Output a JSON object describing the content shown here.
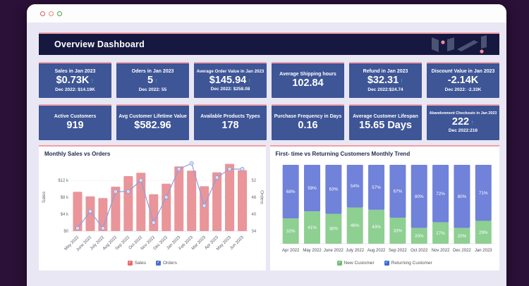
{
  "window": {
    "traffic_lights": [
      "close",
      "minimize",
      "maximize"
    ]
  },
  "header": {
    "title": "Overview Dashboard"
  },
  "kpi_rows": [
    [
      {
        "title": "Sales in Jan 2023",
        "value": "$0.73K",
        "up": true,
        "sub": "Dec 2022: $14.19K"
      },
      {
        "title": "Oders in Jan 2023",
        "value": "5",
        "up": true,
        "sub": "Dec 2022: 55"
      },
      {
        "title": "Average Order Value in Jan 2023",
        "value": "$145.94",
        "up": true,
        "sub": "Dec 2022: $258.08"
      },
      {
        "title": "Average Shipping hours",
        "value": "102.84",
        "up": false,
        "sub": ""
      },
      {
        "title": "Refund in Jan 2023",
        "value": "$32.31",
        "up": true,
        "sub": "Dec 2022:$24.74"
      },
      {
        "title": "Discount Value in Jan 2023",
        "value": "-2.14K",
        "up": false,
        "sub": "Dec 2022: -2.33K"
      }
    ],
    [
      {
        "title": "Active Customers",
        "value": "919",
        "up": false,
        "sub": ""
      },
      {
        "title": "Avg Customer Lifetime Value",
        "value": "$582.96",
        "up": false,
        "sub": ""
      },
      {
        "title": "Available Products Types",
        "value": "178",
        "up": false,
        "sub": ""
      },
      {
        "title": "Purchase Frequency in Days",
        "value": "0.16",
        "up": false,
        "sub": ""
      },
      {
        "title": "Average Customer Lifespan",
        "value": "15.65 Days",
        "up": false,
        "sub": ""
      },
      {
        "title": "Abandonment Checkouts in Jan 2023",
        "value": "222",
        "up": true,
        "sub": "Dec 2022:216"
      }
    ]
  ],
  "chart_data": [
    {
      "type": "bar",
      "subtype": "bar-line-combo",
      "title": "Monthly Sales vs Orders",
      "categories": [
        "May 2022",
        "June 2022",
        "July 2022",
        "Aug 2022",
        "Sep 2022",
        "Oct 2022",
        "Nov 2022",
        "Dec 2022",
        "Jan 2023",
        "Feb 2023",
        "Mar 2023",
        "Apr 2023",
        "May 2023",
        "Jun 2023"
      ],
      "series": [
        {
          "name": "Sales",
          "type": "bar",
          "axis": "left",
          "values": [
            9300,
            8200,
            7800,
            10500,
            13000,
            13800,
            8700,
            11200,
            15300,
            14300,
            10600,
            13900,
            15900,
            14400
          ]
        },
        {
          "name": "Orders",
          "type": "line",
          "axis": "right",
          "values": [
            35,
            41,
            35,
            48,
            48,
            52,
            37,
            46,
            56,
            58,
            43,
            53,
            56,
            56
          ]
        }
      ],
      "y_left": {
        "label": "Sales",
        "ticks": [
          "$0",
          "$4 k",
          "$8 k",
          "$12 k"
        ],
        "tick_values": [
          0,
          4000,
          8000,
          12000
        ],
        "min": 0,
        "max": 16000
      },
      "y_right": {
        "label": "Orders",
        "ticks": [
          "34",
          "40",
          "46",
          "52"
        ],
        "tick_values": [
          34,
          40,
          46,
          52
        ],
        "min": 34,
        "max": 58
      },
      "grid": true,
      "legend_position": "bottom"
    },
    {
      "type": "bar",
      "subtype": "stacked-100",
      "title": "First- time vs Returning  Customers Monthly Trend",
      "categories": [
        "Apr 2022",
        "May 2022",
        "June 2022",
        "July 2022",
        "Aug 2022",
        "Sep 2022",
        "Oct 2022",
        "Nov 2022",
        "Dec 2022",
        "Jan 2023"
      ],
      "series": [
        {
          "name": "New Customer",
          "values": [
            32,
            41,
            38,
            46,
            43,
            33,
            20,
            27,
            20,
            29
          ]
        },
        {
          "name": "Returning Customer",
          "values": [
            68,
            59,
            63,
            54,
            57,
            67,
            80,
            72,
            80,
            71
          ]
        }
      ],
      "value_suffix": "%",
      "ylim": [
        0,
        100
      ],
      "grid": false,
      "legend_position": "bottom"
    }
  ],
  "colors": {
    "accent_pink": "#f1a0a6",
    "header_navy": "#16183f",
    "kpi_card_blue": "#3e5596",
    "teal_up_arrow": "#2fb9a8",
    "sales_bar": "#e9959a",
    "orders_line": "#8f9dda",
    "legend_sales": "#e9696f",
    "legend_orders": "#4a6fd0",
    "new_customer_green": "#8ecf92",
    "returning_customer_blue": "#7082d9",
    "legend_new": "#6fbf73",
    "legend_returning": "#3a6ad4",
    "axis_text": "#666a75",
    "gridline": "#e2e2e9"
  }
}
